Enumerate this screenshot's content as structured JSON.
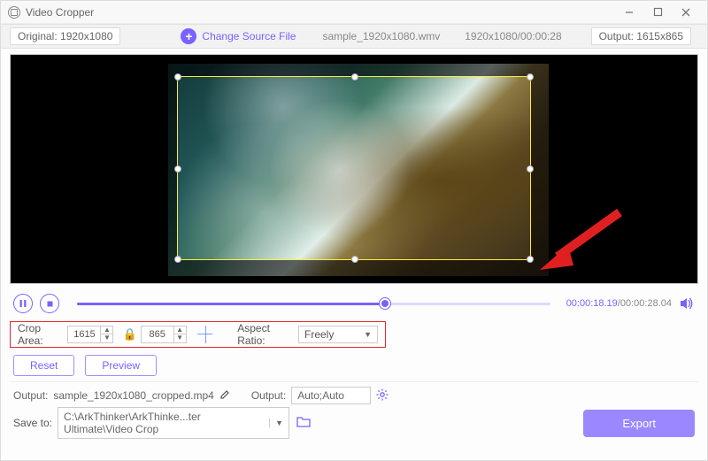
{
  "window": {
    "title": "Video Cropper"
  },
  "infobar": {
    "original_label": "Original:",
    "original_value": "1920x1080",
    "change_source": "Change Source File",
    "filename": "sample_1920x1080.wmv",
    "resolution_time": "1920x1080/00:00:28",
    "output_label": "Output:",
    "output_value": "1615x865"
  },
  "playback": {
    "current_time": "00:00:18.19",
    "total_time": "00:00:28.04",
    "progress_pct": 65
  },
  "crop": {
    "area_label": "Crop Area:",
    "width": "1615",
    "height": "865",
    "aspect_label": "Aspect Ratio:",
    "aspect_value": "Freely"
  },
  "buttons": {
    "reset": "Reset",
    "preview": "Preview",
    "export": "Export"
  },
  "output": {
    "label": "Output:",
    "filename": "sample_1920x1080_cropped.mp4",
    "settings_label": "Output:",
    "settings_value": "Auto;Auto"
  },
  "save": {
    "label": "Save to:",
    "path": "C:\\ArkThinker\\ArkThinke...ter Ultimate\\Video Crop"
  },
  "colors": {
    "accent": "#7b61ff",
    "highlight_border": "#e02a2a"
  }
}
